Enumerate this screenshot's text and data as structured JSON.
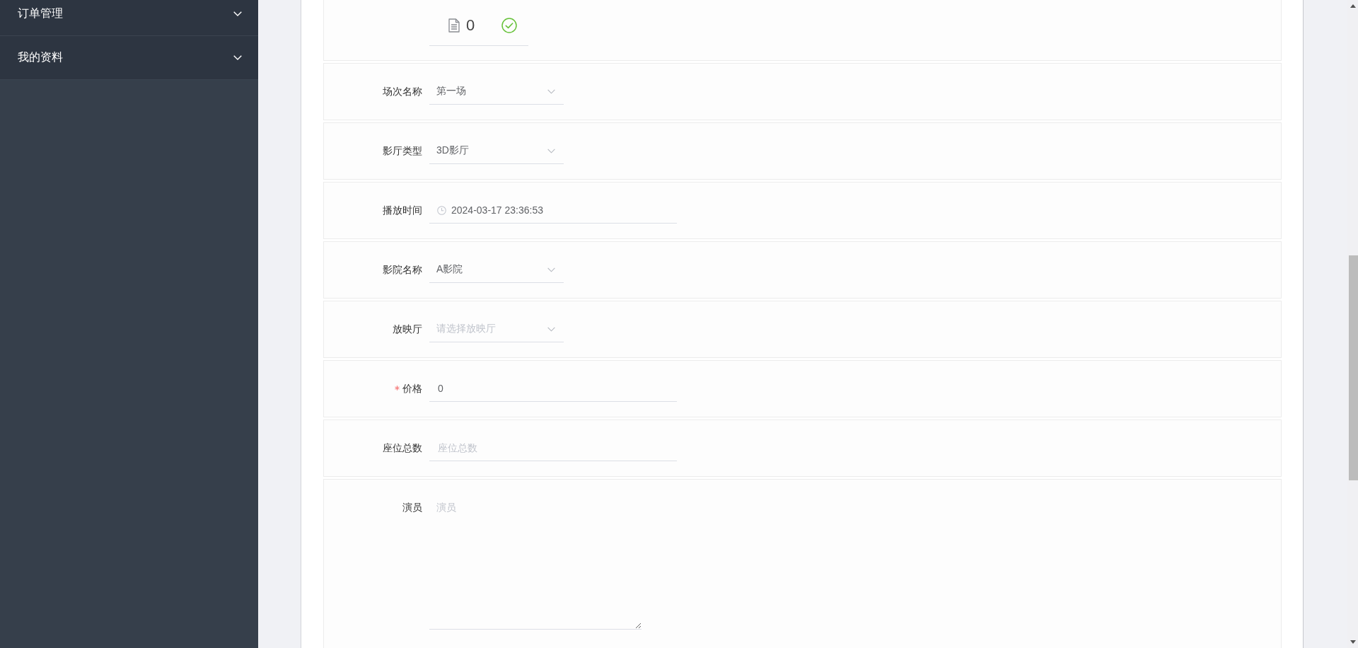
{
  "sidebar": {
    "items": [
      {
        "label": "订单管理",
        "expanded": false
      },
      {
        "label": "我的资料",
        "expanded": false
      }
    ]
  },
  "form": {
    "upload": {
      "file_name": "0",
      "uploaded": true
    },
    "fields": [
      {
        "kind": "select",
        "label": "场次名称",
        "required": false,
        "value": "第一场"
      },
      {
        "kind": "select",
        "label": "影厅类型",
        "required": false,
        "value": "3D影厅"
      },
      {
        "kind": "datetime",
        "label": "播放时间",
        "required": false,
        "value": "2024-03-17 23:36:53"
      },
      {
        "kind": "select",
        "label": "影院名称",
        "required": false,
        "value": "A影院"
      },
      {
        "kind": "select",
        "label": "放映厅",
        "required": false,
        "placeholder": "请选择放映厅"
      },
      {
        "kind": "input",
        "label": "价格",
        "required": true,
        "value": "0"
      },
      {
        "kind": "input",
        "label": "座位总数",
        "required": false,
        "placeholder": "座位总数"
      },
      {
        "kind": "textarea",
        "label": "演员",
        "required": false,
        "placeholder": "演员"
      }
    ]
  }
}
